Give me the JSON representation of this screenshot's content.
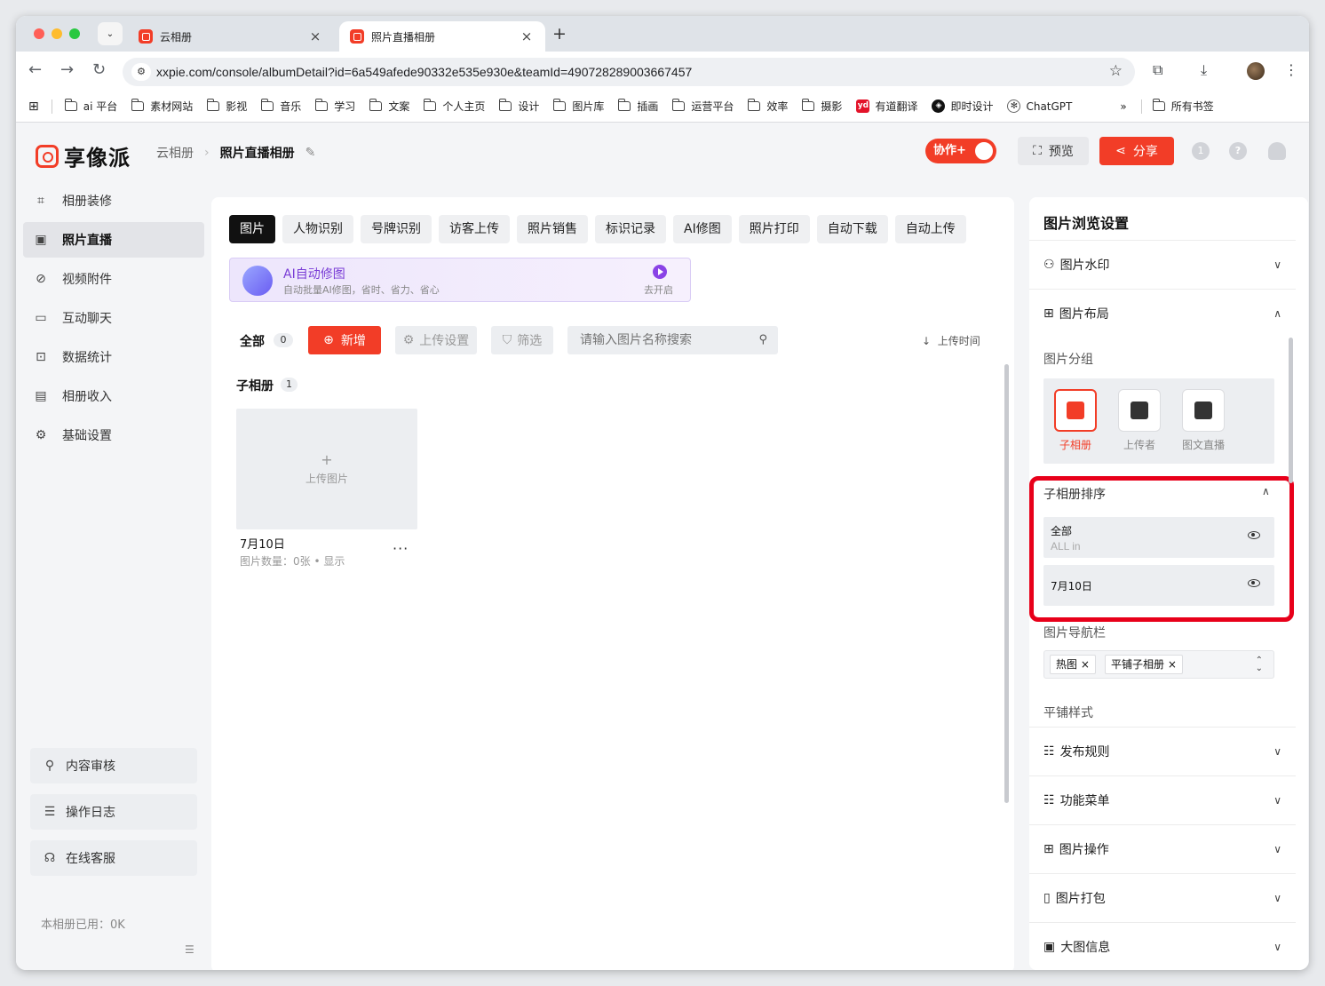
{
  "browser": {
    "tabs": [
      {
        "title": "云相册",
        "active": false
      },
      {
        "title": "照片直播相册",
        "active": true
      }
    ],
    "url": "xxpie.com/console/albumDetail?id=6a549afede90332e535e930e&teamId=490728289003667457",
    "bookmarks": [
      "ai 平台",
      "素材网站",
      "影视",
      "音乐",
      "学习",
      "文案",
      "个人主页",
      "设计",
      "图片库",
      "插画",
      "运营平台",
      "效率",
      "摄影",
      "有道翻译",
      "即时设计",
      "ChatGPT"
    ],
    "bookmarks_more": "»",
    "all_bookmarks": "所有书签"
  },
  "header": {
    "logo": "享像派",
    "breadcrumb_parent": "云相册",
    "breadcrumb_current": "照片直播相册",
    "collab_label": "协作+",
    "preview_label": "预览",
    "share_label": "分享"
  },
  "sidebar": {
    "items": [
      {
        "label": "相册装修",
        "icon": "frame-icon"
      },
      {
        "label": "照片直播",
        "icon": "image-icon",
        "active": true
      },
      {
        "label": "视频附件",
        "icon": "paperclip-icon"
      },
      {
        "label": "互动聊天",
        "icon": "chat-icon"
      },
      {
        "label": "数据统计",
        "icon": "chart-icon"
      },
      {
        "label": "相册收入",
        "icon": "wallet-icon"
      },
      {
        "label": "基础设置",
        "icon": "gear-icon"
      }
    ],
    "bottom": [
      {
        "label": "内容审核",
        "icon": "stamp-icon"
      },
      {
        "label": "操作日志",
        "icon": "log-icon"
      },
      {
        "label": "在线客服",
        "icon": "headset-icon"
      }
    ],
    "storage": "本相册已用：0K"
  },
  "main": {
    "feature_tabs": [
      "图片",
      "人物识别",
      "号牌识别",
      "访客上传",
      "照片销售",
      "标识记录",
      "AI修图",
      "照片打印",
      "自动下载",
      "自动上传"
    ],
    "ai_banner": {
      "title": "AI自动修图",
      "subtitle": "自动批量AI修图，省时、省力、省心",
      "action": "去开启"
    },
    "toolbar": {
      "all_label": "全部",
      "all_count": "0",
      "add_label": "新增",
      "upload_settings": "上传设置",
      "filter": "筛选",
      "search_placeholder": "请输入图片名称搜索",
      "sort_label": "上传时间"
    },
    "sub_albums": {
      "label": "子相册",
      "count": "1",
      "card": {
        "upload_label": "上传图片",
        "title": "7月10日",
        "meta": "图片数量：0张 • 显示",
        "more": "···"
      }
    }
  },
  "right_panel": {
    "title": "图片浏览设置",
    "watermark": "图片水印",
    "layout": "图片布局",
    "group_label": "图片分组",
    "group_options": [
      {
        "label": "子相册",
        "selected": true
      },
      {
        "label": "上传者",
        "selected": false
      },
      {
        "label": "图文直播",
        "selected": false
      }
    ],
    "sort_title": "子相册排序",
    "sort_items": [
      {
        "name": "全部",
        "sub": "ALL in"
      },
      {
        "name": "7月10日",
        "sub": ""
      }
    ],
    "nav_label": "图片导航栏",
    "nav_chips": [
      "热图",
      "平铺子相册"
    ],
    "tile_label": "平铺样式",
    "sections": [
      "发布规则",
      "功能菜单",
      "图片操作",
      "图片打包",
      "大图信息"
    ]
  },
  "colors": {
    "accent": "#f23d27",
    "highlight": "#e8001a",
    "ai_purple": "#7a3dd6"
  }
}
